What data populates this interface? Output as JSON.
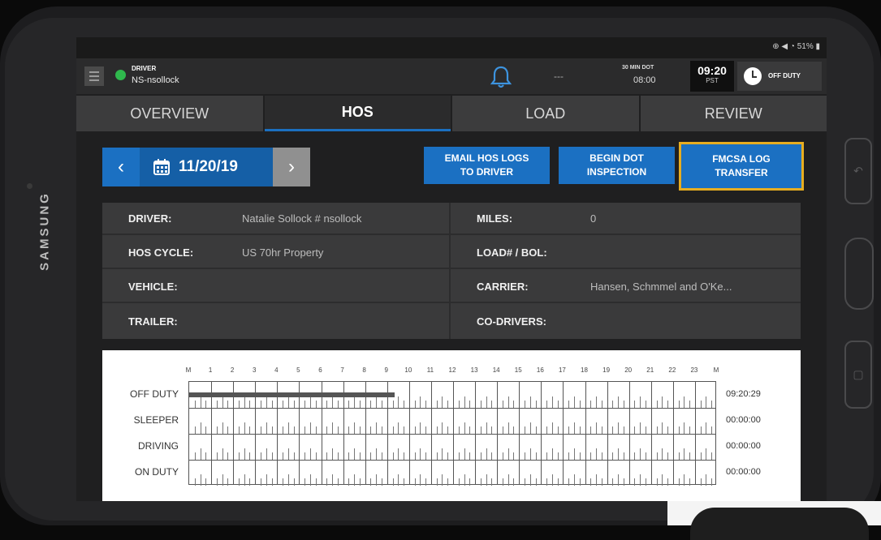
{
  "device": {
    "brand": "SAMSUNG"
  },
  "statusbar": {
    "icons": "⊕ ◀ ◔ 51% ▮"
  },
  "header": {
    "driver_label": "DRIVER",
    "driver_name": "NS-nsollock",
    "dash": "---",
    "dot_label": "30 MIN DOT",
    "dot_value": "08:00",
    "time": "09:20",
    "timezone": "PST",
    "duty_status": "OFF DUTY",
    "icons": [
      "menu-icon",
      "status-dot-icon",
      "bell-icon",
      "clock-icon"
    ]
  },
  "tabs": [
    {
      "label": "OVERVIEW"
    },
    {
      "label": "HOS"
    },
    {
      "label": "LOAD"
    },
    {
      "label": "REVIEW"
    }
  ],
  "date_nav": {
    "prev": "‹",
    "date": "11/20/19",
    "next": "›"
  },
  "actions": {
    "email_line1": "EMAIL HOS LOGS",
    "email_line2": "TO DRIVER",
    "dot_line1": "BEGIN DOT",
    "dot_line2": "INSPECTION",
    "fmcsa_line1": "FMCSA LOG",
    "fmcsa_line2": "TRANSFER"
  },
  "info": {
    "driver_label": "DRIVER:",
    "driver_value": "Natalie Sollock # nsollock",
    "hos_cycle_label": "HOS CYCLE:",
    "hos_cycle_value": "US 70hr Property",
    "vehicle_label": "VEHICLE:",
    "vehicle_value": "",
    "trailer_label": "TRAILER:",
    "trailer_value": "",
    "miles_label": "MILES:",
    "miles_value": "0",
    "load_label": "LOAD# / BOL:",
    "load_value": "",
    "carrier_label": "CARRIER:",
    "carrier_value": "Hansen, Schmmel and O'Ke...",
    "codrivers_label": "CO-DRIVERS:",
    "codrivers_value": ""
  },
  "log_chart": {
    "hours": [
      "M",
      "1",
      "2",
      "3",
      "4",
      "5",
      "6",
      "7",
      "8",
      "9",
      "10",
      "11",
      "12",
      "13",
      "14",
      "15",
      "16",
      "17",
      "18",
      "19",
      "20",
      "21",
      "22",
      "23",
      "M"
    ],
    "rows": [
      {
        "label": "OFF DUTY",
        "total": "09:20:29"
      },
      {
        "label": "SLEEPER",
        "total": "00:00:00"
      },
      {
        "label": "DRIVING",
        "total": "00:00:00"
      },
      {
        "label": "ON DUTY",
        "total": "00:00:00"
      }
    ],
    "off_duty_hours": 9.34
  }
}
